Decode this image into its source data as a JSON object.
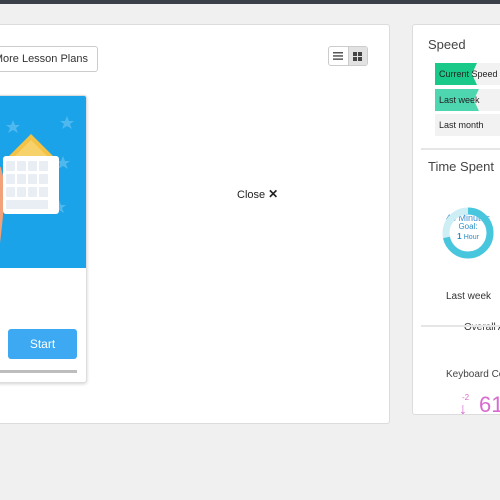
{
  "toolbar": {
    "more_lesson_plans": "More Lesson Plans",
    "view_list_icon": "list-view-icon",
    "view_grid_icon": "grid-view-icon"
  },
  "lesson_card": {
    "start_label": "Start",
    "image_icon": "keyboard-hands-illustration",
    "accent": "#1aa3e8",
    "button_color": "#3ca9f2"
  },
  "overlay": {
    "close_label": "Close",
    "close_glyph": "✕"
  },
  "sidebar": {
    "speed": {
      "title": "Speed",
      "rows": [
        {
          "label": "Current Speed",
          "color": "#19c98a"
        },
        {
          "label": "Last week",
          "color": "#4ed6b0"
        },
        {
          "label": "Last month",
          "color": "#f2f2f2"
        }
      ]
    },
    "time_spent": {
      "title": "Time Spent",
      "minutes": "43 Minutes",
      "goal_label": "Goal:",
      "goal_value": "1",
      "goal_unit": "Hour",
      "period": "Last week",
      "overall": "Overall A",
      "ring_color": "#47c6dd"
    },
    "keyboard": {
      "title": "Keyboard Co",
      "delta": "-2",
      "value": "61",
      "color": "#d86bd0"
    }
  }
}
